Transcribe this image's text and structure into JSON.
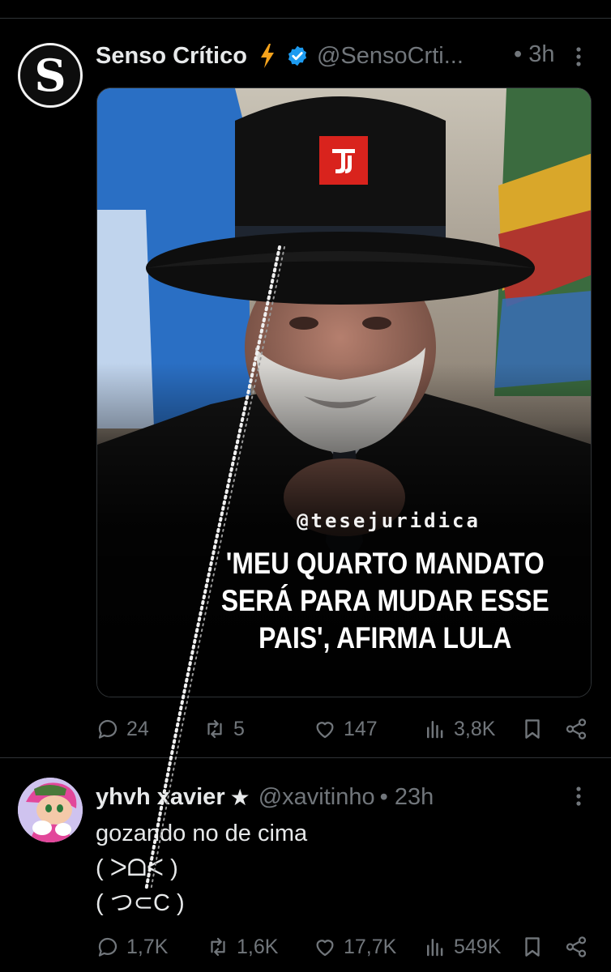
{
  "tweet1": {
    "author_name": "Senso Crítico",
    "avatar_letter": "S",
    "handle": "@SensoCrti...",
    "time": "• 3h",
    "media": {
      "brand_logo_text": "TJ",
      "overlay_handle": "@tesejuridica",
      "headline_lines": [
        "'MEU QUARTO MANDATO",
        "SERÁ PARA MUDAR ESSE",
        "PAIS', AFIRMA LULA"
      ]
    },
    "actions": {
      "replies": "24",
      "reposts": "5",
      "likes": "147",
      "views": "3,8K"
    }
  },
  "tweet2": {
    "author_name": "yhvh xavier",
    "star": "★",
    "handle": "@xavitinho",
    "time": "• 23h",
    "text_lines": [
      "gozando no de cima",
      "( ᐳᗝᐸ )",
      "( つ⊂C )"
    ],
    "actions": {
      "replies": "1,7K",
      "reposts": "1,6K",
      "likes": "17,7K",
      "views": "549K"
    }
  },
  "icons": {
    "reply": "reply-icon",
    "repost": "repost-icon",
    "like": "heart-icon",
    "views": "views-icon",
    "bookmark": "bookmark-icon",
    "share": "share-icon",
    "verified": "verified-badge-icon",
    "affiliate": "lightning-icon",
    "more": "more-dots-icon"
  },
  "colors": {
    "background": "#000000",
    "text": "#e7e9ea",
    "muted": "#71767b",
    "verified_blue": "#1d9bf0",
    "bolt_orange": "#f4a21c",
    "brand_red": "#d9231d"
  }
}
